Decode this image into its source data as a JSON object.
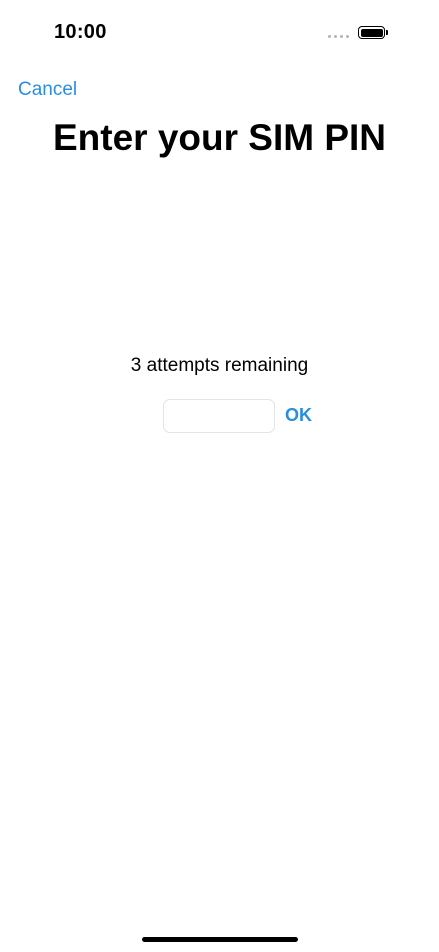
{
  "status_bar": {
    "time": "10:00",
    "signal_icon": "cellular-dots-icon",
    "battery_icon": "battery-icon",
    "battery_level": 1.0
  },
  "nav": {
    "cancel_label": "Cancel"
  },
  "main": {
    "title": "Enter your SIM PIN",
    "attempts_text": "3 attempts remaining",
    "pin_input_value": "",
    "pin_input_placeholder": "",
    "ok_label": "OK"
  },
  "colors": {
    "accent": "#2a8ee0",
    "background": "#ffffff",
    "text": "#000000"
  }
}
